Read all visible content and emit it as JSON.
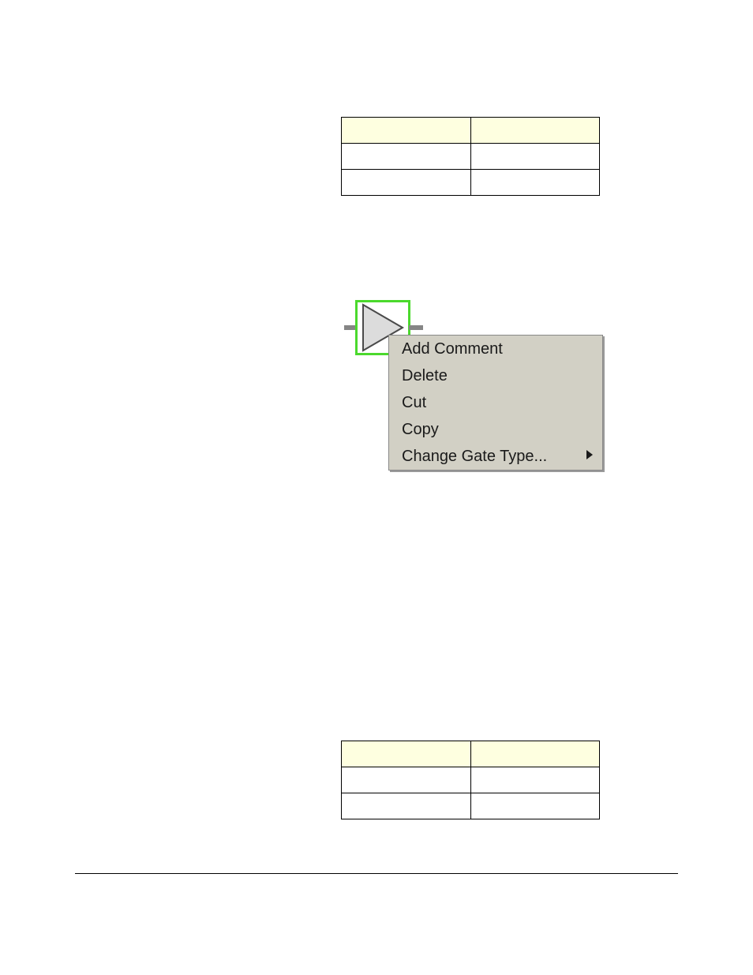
{
  "table1": {
    "header": [
      "",
      ""
    ],
    "rows": [
      [
        "",
        ""
      ],
      [
        "",
        ""
      ]
    ]
  },
  "table2": {
    "header": [
      "",
      ""
    ],
    "rows": [
      [
        "",
        ""
      ],
      [
        "",
        ""
      ]
    ]
  },
  "context_menu": {
    "items": [
      {
        "label": "Add Comment",
        "has_submenu": false
      },
      {
        "label": "Delete",
        "has_submenu": false
      },
      {
        "label": "Cut",
        "has_submenu": false
      },
      {
        "label": "Copy",
        "has_submenu": false
      },
      {
        "label": "Change Gate Type...",
        "has_submenu": true
      }
    ]
  },
  "colors": {
    "selection": "#4bd92d",
    "menu_bg": "#d2d0c5",
    "table_header_bg": "#feffe0"
  }
}
